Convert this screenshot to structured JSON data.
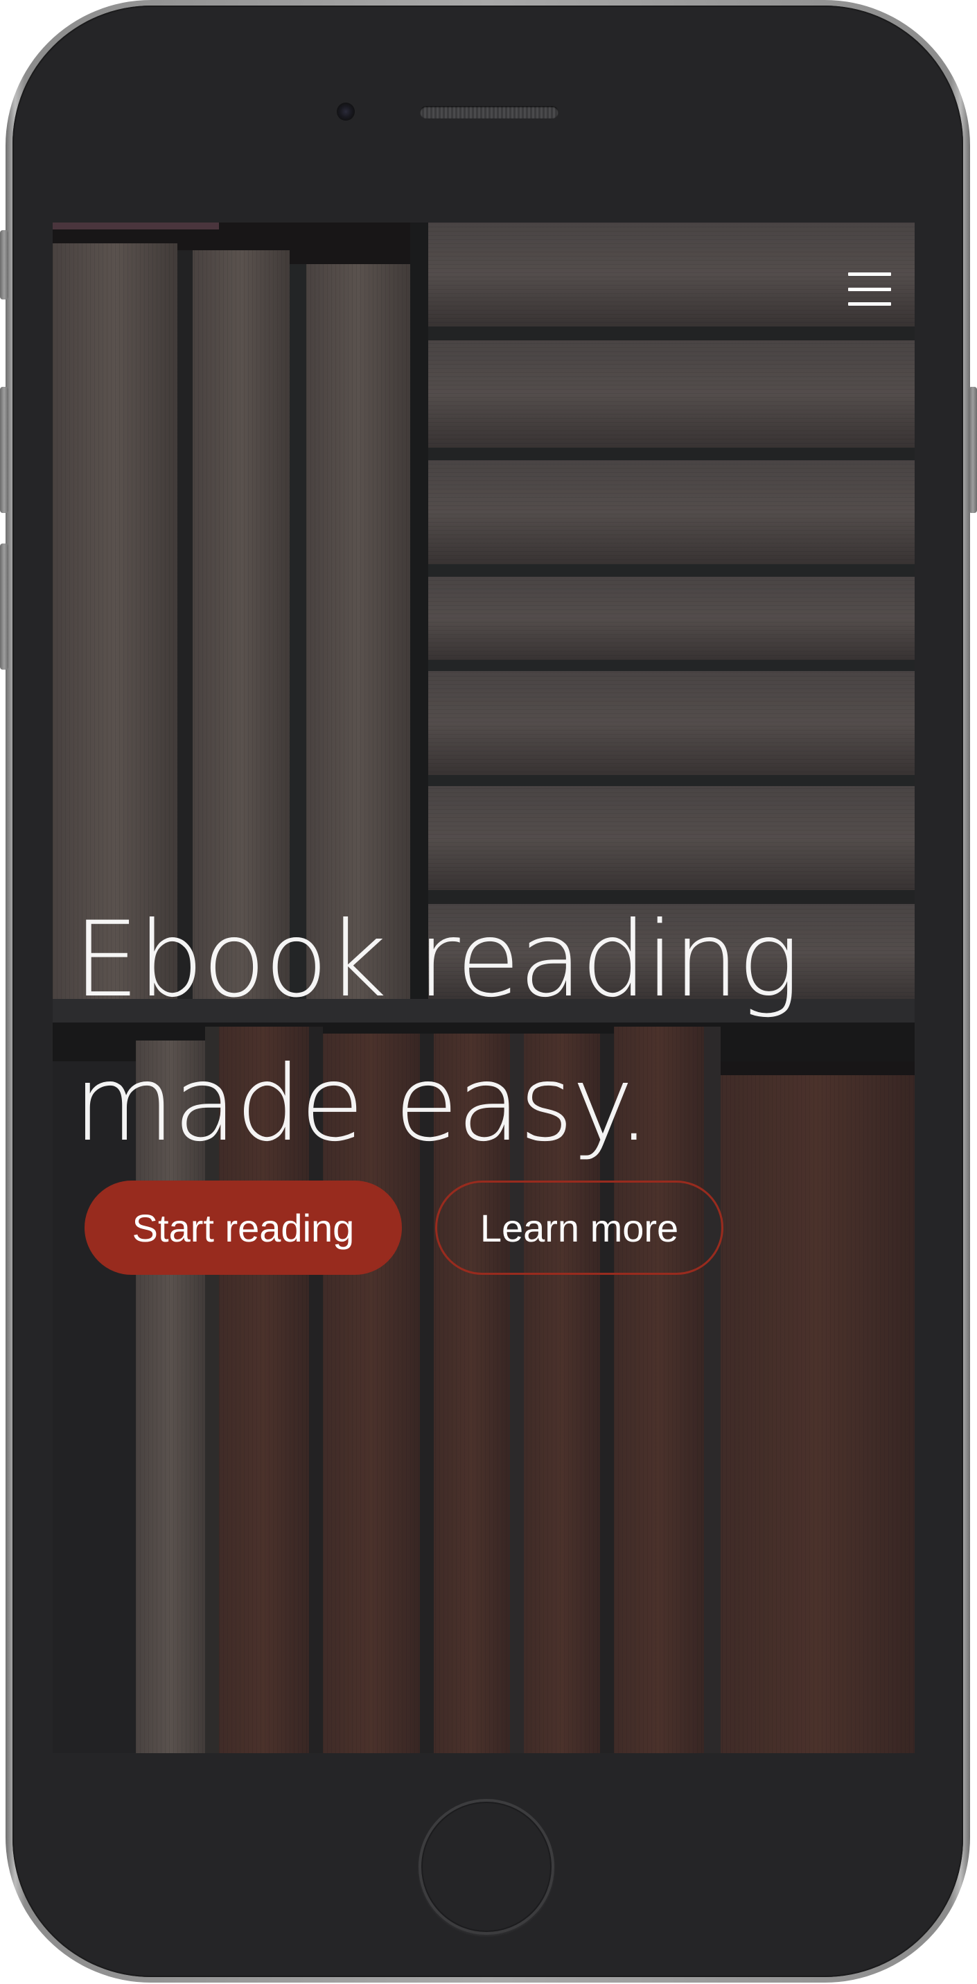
{
  "device": {
    "type": "smartphone",
    "body_color": "#252527",
    "frame_color": "#a9a9a9"
  },
  "header": {
    "menu_icon": "hamburger-menu-icon"
  },
  "hero": {
    "title_line1": "Ebook reading",
    "title_line2": "made easy.",
    "background": "bookshelf-photo"
  },
  "actions": {
    "primary_label": "Start reading",
    "secondary_label": "Learn more",
    "accent_color": "#982b1e"
  }
}
